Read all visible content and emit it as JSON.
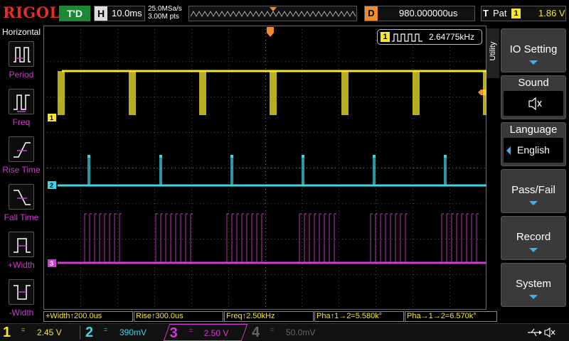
{
  "header": {
    "brand": "RIGOL",
    "run_state": "T'D",
    "horizontal_label": "H",
    "timebase": "10.0ms",
    "sample_rate": "25.0MSa/s",
    "memory_depth": "3.00M pts",
    "delay_label": "D",
    "delay_value": "980.000000us",
    "trigger_label": "T",
    "trigger_type": "Pat",
    "trigger_source": "1",
    "trigger_level": "1.86 V",
    "trigger_marker": "T"
  },
  "left_menu": {
    "title": "Horizontal",
    "items": [
      {
        "label": "Period",
        "icon": "period-icon"
      },
      {
        "label": "Freq",
        "icon": "frequency-icon"
      },
      {
        "label": "Rise Time",
        "icon": "rise-time-icon"
      },
      {
        "label": "Fall Time",
        "icon": "fall-time-icon"
      },
      {
        "label": "+Width",
        "icon": "positive-width-icon"
      },
      {
        "label": "-Width",
        "icon": "negative-width-icon"
      }
    ]
  },
  "freq_badge": {
    "channel": "1",
    "value": "2.64775kHz"
  },
  "channel_markers": {
    "ch1": "1",
    "ch2": "2",
    "ch3": "3"
  },
  "right_menu": {
    "tab": "Utility",
    "io_setting": "IO Setting",
    "sound_label": "Sound",
    "sound_icon": "speaker-muted-icon",
    "language_label": "Language",
    "language_value": "English",
    "pass_fail": "Pass/Fail",
    "record": "Record",
    "system": "System"
  },
  "measurements": [
    "+Width↑200.0us",
    "Rise↑300.0us",
    "Freq↑2.50kHz",
    "Pha↑1→2=5.580k°",
    "Pha→1→2=6.570k°"
  ],
  "channels": [
    {
      "num": "1",
      "coupling": "=",
      "scale": "2.45 V",
      "color": "#f5e72a"
    },
    {
      "num": "2",
      "coupling": "=",
      "scale": "390mV",
      "color": "#3ad6e6"
    },
    {
      "num": "3",
      "coupling": "=",
      "scale": "2.50 V",
      "color": "#d23cd2"
    },
    {
      "num": "4",
      "coupling": "=",
      "scale": "50.0mV",
      "color": "#555555"
    }
  ],
  "colors": {
    "ch1": "#f5e72a",
    "ch2": "#3ad6e6",
    "ch3": "#d23cd2",
    "trigger": "#f08c2a",
    "accent": "#3ab0f0"
  }
}
